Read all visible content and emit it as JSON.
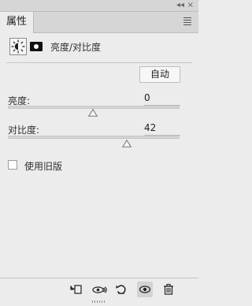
{
  "panel": {
    "tab_label": "属性",
    "title": "亮度/对比度",
    "collapse_glyph": "◂◂",
    "close_glyph": "×"
  },
  "mode": {
    "adjustment_icon": "sun-icon",
    "mask_icon": "mask-icon"
  },
  "controls": {
    "auto_label": "自动",
    "brightness_label": "亮度:",
    "brightness_value": "0",
    "brightness_slider": 0.5,
    "contrast_label": "对比度:",
    "contrast_value": "42",
    "contrast_slider": 0.678,
    "legacy_label": "使用旧版"
  },
  "footer": {
    "clip_icon": "clip-to-layer-icon",
    "preview_icon": "view-previous-state-icon",
    "reset_icon": "reset-icon",
    "visibility_icon": "eye-icon",
    "delete_icon": "trash-icon"
  }
}
